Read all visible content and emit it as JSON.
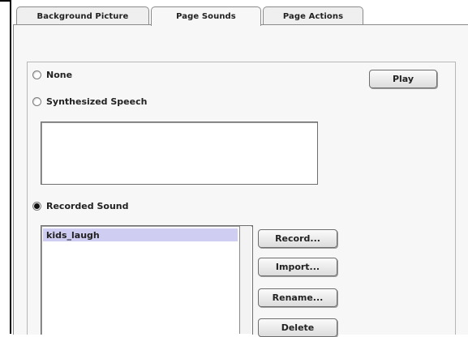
{
  "tabs": [
    {
      "label": "Background Picture"
    },
    {
      "label": "Page Sounds"
    },
    {
      "label": "Page Actions"
    }
  ],
  "options": {
    "none": "None",
    "synth": "Synthesized Speech",
    "recorded": "Recorded Sound"
  },
  "buttons": {
    "play": "Play",
    "record": "Record...",
    "import": "Import...",
    "rename": "Rename...",
    "delete": "Delete"
  },
  "sounds_list": [
    "kids_laugh"
  ],
  "synth_text": ""
}
